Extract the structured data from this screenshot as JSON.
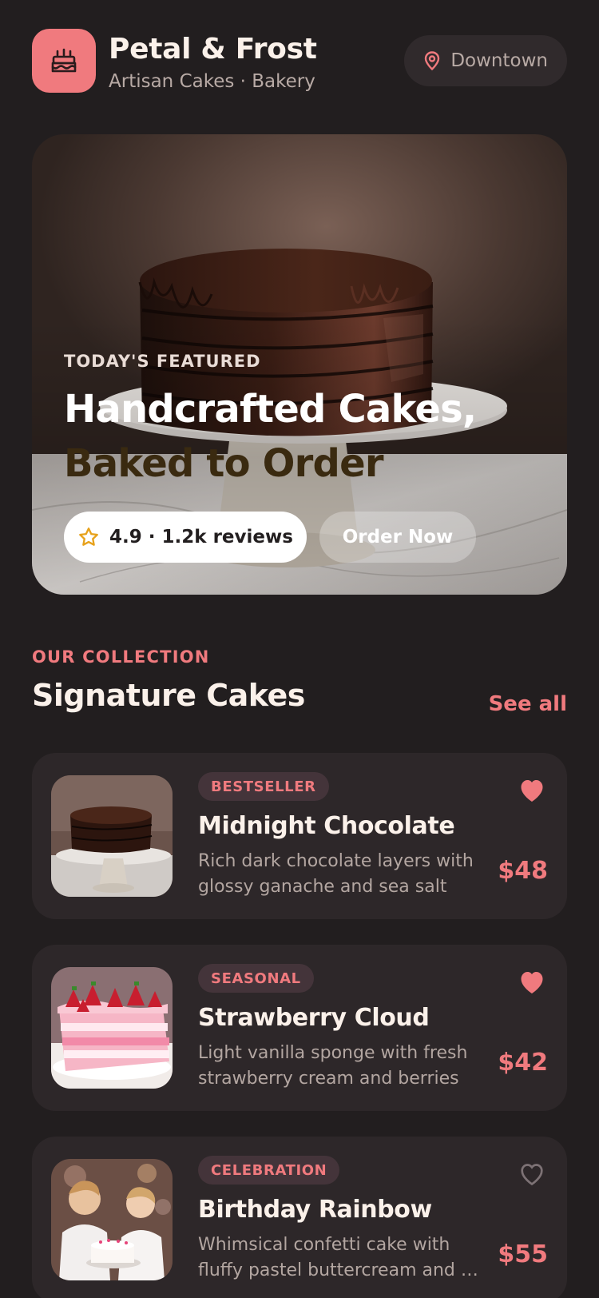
{
  "header": {
    "brand_name": "Petal & Frost",
    "brand_sub": "Artisan Cakes · Bakery",
    "location": "Downtown"
  },
  "hero": {
    "kicker": "TODAY'S FEATURED",
    "title_line1": "Handcrafted Cakes,",
    "title_line2": "Baked to Order",
    "rating": "4.9 · 1.2k reviews",
    "cta": "Order Now"
  },
  "section": {
    "kicker": "OUR COLLECTION",
    "title": "Signature Cakes",
    "see_all": "See all"
  },
  "cakes": [
    {
      "badge": "BESTSELLER",
      "name": "Midnight Chocolate",
      "desc_line1": "Rich dark chocolate layers with",
      "desc_line2": "glossy ganache and sea salt",
      "price": "$48",
      "favorited": true
    },
    {
      "badge": "SEASONAL",
      "name": "Strawberry Cloud",
      "desc_line1": "Light vanilla sponge with fresh",
      "desc_line2": "strawberry cream and berries",
      "price": "$42",
      "favorited": true
    },
    {
      "badge": "CELEBRATION",
      "name": "Birthday Rainbow",
      "desc_line1": "Whimsical confetti cake with",
      "desc_line2": "fluffy pastel buttercream and …",
      "price": "$55",
      "favorited": false
    }
  ],
  "colors": {
    "background": "#221e1f",
    "accent": "#f07a7e",
    "card": "#2d2729",
    "text": "#fbf1ea",
    "muted": "#b3a6a1"
  },
  "icons": {
    "logo": "cake-icon",
    "location": "map-pin-icon",
    "rating": "star-icon",
    "favorite": "heart-icon"
  }
}
